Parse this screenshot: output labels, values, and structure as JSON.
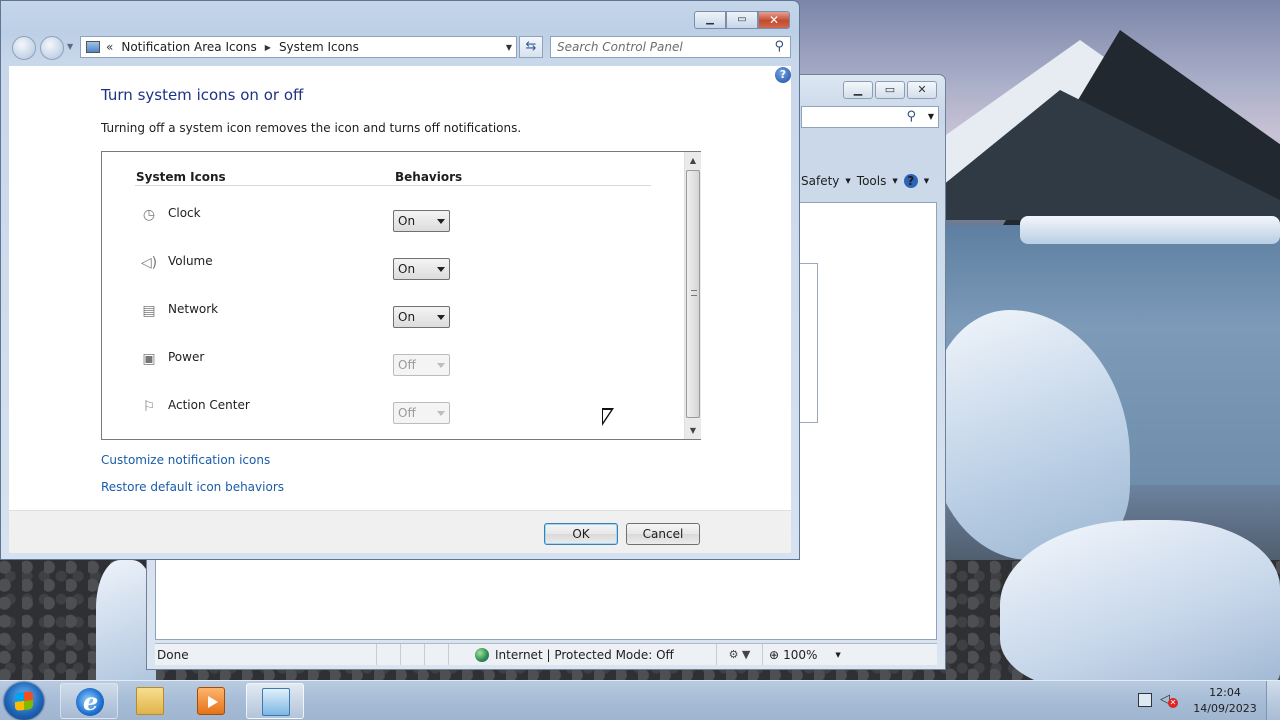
{
  "dialog": {
    "breadcrumbs": [
      "Notification Area Icons",
      "System Icons"
    ],
    "search_placeholder": "Search Control Panel",
    "title": "Turn system icons on or off",
    "description": "Turning off a system icon removes the icon and turns off notifications.",
    "columns": {
      "system_icons": "System Icons",
      "behaviors": "Behaviors"
    },
    "icons": [
      {
        "name": "Clock",
        "icon": "clock-icon",
        "behavior": "On",
        "enabled": true
      },
      {
        "name": "Volume",
        "icon": "volume-icon",
        "behavior": "On",
        "enabled": true
      },
      {
        "name": "Network",
        "icon": "network-icon",
        "behavior": "On",
        "enabled": true
      },
      {
        "name": "Power",
        "icon": "power-icon",
        "behavior": "Off",
        "enabled": false
      },
      {
        "name": "Action Center",
        "icon": "flag-icon",
        "behavior": "Off",
        "enabled": false
      }
    ],
    "links": {
      "customize": "Customize notification icons",
      "restore": "Restore default icon behaviors"
    },
    "buttons": {
      "ok": "OK",
      "cancel": "Cancel"
    }
  },
  "ie_window": {
    "menu": {
      "safety": "Safety",
      "tools": "Tools"
    },
    "status": {
      "text": "Done",
      "zone": "Internet | Protected Mode: Off",
      "zoom": "100%"
    }
  },
  "taskbar": {
    "pinned": [
      "internet-explorer-icon",
      "windows-explorer-icon",
      "media-player-icon",
      "control-panel-icon"
    ],
    "clock": {
      "time": "12:04",
      "date": "14/09/2023"
    }
  },
  "colors": {
    "title_blue": "#1e3287",
    "link_blue": "#1a5ca8",
    "close_red": "#c44a2c"
  }
}
